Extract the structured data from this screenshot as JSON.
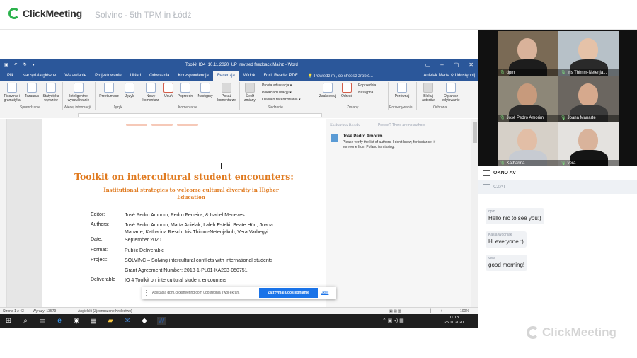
{
  "app": {
    "logo_text": "ClickMeeting",
    "event_title": "Solvinc - 5th TPM in Łódź"
  },
  "word": {
    "doc_title": "Toolkit IO4_10.11.2020_UP_revised feedback Mainz - Word",
    "tabs": [
      "Plik",
      "Narzędzia główne",
      "Wstawianie",
      "Projektowanie",
      "Układ",
      "Odwołania",
      "Korespondencja",
      "Recenzja",
      "Widok",
      "Foxit Reader PDF"
    ],
    "active_tab": "Recenzja",
    "tell_me": "Powiedz mi, co chcesz zrobić...",
    "user": "Anielak Marta",
    "share_label": "Udostępnij",
    "ribbon": {
      "pisownia": "Pisownia i gramatyka",
      "tezaurus": "Tezaurus",
      "statystyka": "Statystyka wyrazów",
      "inteligentne": "Inteligentne wyszukiwanie",
      "przetlumacz": "Przetłumacz",
      "jezyk": "Język",
      "nowy": "Nowy komentarz",
      "usun": "Usuń",
      "poprzedni": "Poprzedni",
      "nastepny": "Następny",
      "pokaz_komentarze": "Pokaż komentarze",
      "sledz": "Śledź zmiany",
      "prosta": "Prosta adiustacja",
      "pokaz_adiustacje": "Pokaż adiustację",
      "okienko": "Okienko recenzowania",
      "zaakceptuj": "Zaakceptuj",
      "odrzuc": "Odrzuć",
      "poprzednia": "Poprzednia",
      "nastepna": "Następna",
      "porownaj": "Porównaj",
      "blokuj": "Blokuj autorów",
      "ogranicz": "Ogranicz edytowanie",
      "groups": {
        "sprawdzanie": "Sprawdzanie",
        "wiecej": "Więcej informacji",
        "jezyk": "Język",
        "komentarze": "Komentarze",
        "sledzenie": "Śledzenie",
        "zmiany": "Zmiany",
        "porownywanie": "Porównywanie",
        "ochrona": "Ochrona"
      }
    },
    "document": {
      "title": "Toolkit on intercultural student encounters:",
      "subtitle": "Institutional strategies to welcome cultural diversity in Higher Education",
      "fields": [
        {
          "label": "Editor:",
          "value": "José Pedro Amorim, Pedro Ferreira, & Isabel Menezes"
        },
        {
          "label": "Authors:",
          "value": "José Pedro Amorim, Marta Anielak, Laleh Esteki, Beate Hörr, Joana Manarte, Katharina Resch, Iris Thimm-Netenjakob, Vera Varhegyi"
        },
        {
          "label": "Date:",
          "value": "September 2020"
        },
        {
          "label": "Format:",
          "value": "Public Deliverable"
        },
        {
          "label": "Project:",
          "value": "SOLVINC – Solving intercultural conflicts with international students"
        },
        {
          "label": "",
          "value": "Grant Agreement Number: 2018-1-PL01-KA203-050751"
        },
        {
          "label": "Deliverable",
          "value": "IO 4 Toolkit on intercultural student encounters"
        }
      ]
    },
    "markup": {
      "top_name": "Katharina Resch",
      "top_prot": "Protect? There are no authors",
      "comment_author": "José Pedro Amorim",
      "comment_text": "Please verify the list of authors. I don't know, for instance, if someone from Poland is missing."
    },
    "status": {
      "page": "Strona 1 z 43",
      "words": "Wyrazy: 13579",
      "lang": "Angielski (Zjednoczone Królestwo)",
      "zoom": "100%"
    }
  },
  "taskbar": {
    "time": "11:18",
    "date": "25.11.2020"
  },
  "sharebar": {
    "message": "Aplikacja dpm.clickmeeting.com udostępnia Twój ekran.",
    "stop": "Zatrzymaj udostępnianie",
    "hide": "Ukryj"
  },
  "participants": [
    {
      "name": "dpm",
      "bg": "#7a6a55",
      "skin": "#d9b29a",
      "shirt": "#1d1d1d"
    },
    {
      "name": "Iris Thimm-Netenja...",
      "bg": "#b7c1c8",
      "skin": "#e5c2a8",
      "shirt": "#2a2a2a"
    },
    {
      "name": "José Pedro Amorim",
      "bg": "#8d8778",
      "skin": "#c79a7c",
      "shirt": "#2b2b2b"
    },
    {
      "name": "Joana Manarte",
      "bg": "#6b6660",
      "skin": "#d6a98d",
      "shirt": "#3b3b3b"
    },
    {
      "name": "Katharina",
      "bg": "#d6d0c8",
      "skin": "#e2bea6",
      "shirt": "#c7cbd2"
    },
    {
      "name": "vera",
      "bg": "#e4e2df",
      "skin": "#d9b39b",
      "shirt": "#151515"
    }
  ],
  "sections": {
    "okno": "OKNO AV",
    "czat": "CZAT"
  },
  "chat": [
    {
      "author": "dpm",
      "text": "Hello nic to see you:)"
    },
    {
      "author": "Kasia Wodniak",
      "text": "Hi everyone :)"
    },
    {
      "author": "vera",
      "text": "good morning!"
    }
  ],
  "watermark": "ClickMeeting",
  "colors": {
    "word_blue": "#2b579a",
    "doc_orange": "#e07a1f",
    "mic_green": "#7ee07e",
    "stop_blue": "#1a73e8",
    "brand_green": "#2bb24c"
  }
}
